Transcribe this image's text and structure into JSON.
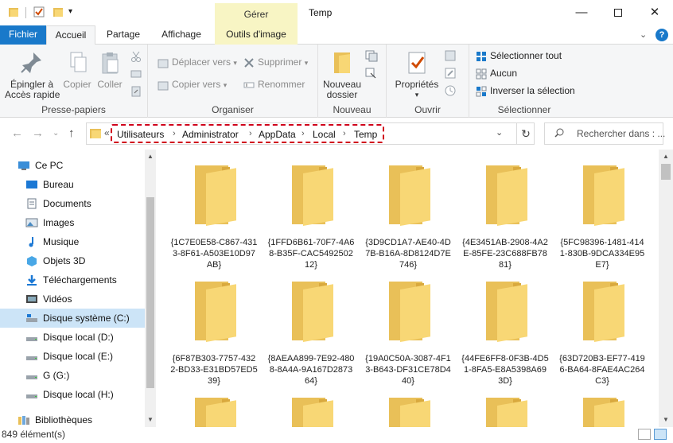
{
  "window": {
    "title": "Temp",
    "context_tab_header": "Gérer",
    "minimize": "—",
    "close": "✕"
  },
  "ribbon_tabs": [
    "Fichier",
    "Accueil",
    "Partage",
    "Affichage",
    "Outils d'image"
  ],
  "help": "?",
  "ribbon": {
    "presse_papiers": {
      "label": "Presse-papiers",
      "pin": "Épingler à\nAccès rapide",
      "copy": "Copier",
      "paste": "Coller"
    },
    "organiser": {
      "label": "Organiser",
      "move_to": "Déplacer vers",
      "copy_to": "Copier vers",
      "delete": "Supprimer",
      "rename": "Renommer"
    },
    "nouveau": {
      "label": "Nouveau",
      "new_folder": "Nouveau\ndossier"
    },
    "ouvrir": {
      "label": "Ouvrir",
      "properties": "Propriétés"
    },
    "selectionner": {
      "label": "Sélectionner",
      "select_all": "Sélectionner tout",
      "select_none": "Aucun",
      "invert": "Inverser la sélection"
    }
  },
  "address": {
    "prefix": "«",
    "crumbs": [
      "Utilisateurs",
      "Administrator",
      "AppData",
      "Local",
      "Temp"
    ],
    "separator": "›"
  },
  "search": {
    "placeholder": "Rechercher dans : ..."
  },
  "sidebar": [
    {
      "label": "Ce PC",
      "icon": "pc-icon",
      "indent": 0
    },
    {
      "label": "Bureau",
      "icon": "desktop-icon",
      "indent": 1
    },
    {
      "label": "Documents",
      "icon": "documents-icon",
      "indent": 1
    },
    {
      "label": "Images",
      "icon": "images-icon",
      "indent": 1
    },
    {
      "label": "Musique",
      "icon": "music-icon",
      "indent": 1
    },
    {
      "label": "Objets 3D",
      "icon": "objects3d-icon",
      "indent": 1
    },
    {
      "label": "Téléchargements",
      "icon": "downloads-icon",
      "indent": 1
    },
    {
      "label": "Vidéos",
      "icon": "videos-icon",
      "indent": 1
    },
    {
      "label": "Disque système (C:)",
      "icon": "system-drive-icon",
      "indent": 1,
      "selected": true
    },
    {
      "label": "Disque local (D:)",
      "icon": "drive-icon",
      "indent": 1
    },
    {
      "label": "Disque local (E:)",
      "icon": "drive-icon",
      "indent": 1
    },
    {
      "label": "G (G:)",
      "icon": "drive-icon",
      "indent": 1
    },
    {
      "label": "Disque local (H:)",
      "icon": "drive-icon",
      "indent": 1
    },
    {
      "label": "Bibliothèques",
      "icon": "libraries-icon",
      "indent": 0
    }
  ],
  "folders": [
    "{1C7E0E58-C867-4313-8F61-A503E10D97AB}",
    "{1FFD6B61-70F7-4A68-B35F-CAC549250212}",
    "{3D9CD1A7-AE40-4D7B-B16A-8D8124D7E746}",
    "{4E3451AB-2908-4A2E-85FE-23C688FB7881}",
    "{5FC98396-1481-4141-830B-9DCA334E95E7}",
    "{6F87B303-7757-4322-BD33-E31BD57ED539}",
    "{8AEAA899-7E92-4808-8A4A-9A167D287364}",
    "{19A0C50A-3087-4F13-B643-DF31CE78D440}",
    "{44FE6FF8-0F3B-4D51-8FA5-E8A5398A693D}",
    "{63D720B3-EF77-4196-BA64-8FAE4AC264C3}",
    "",
    "",
    "",
    "",
    ""
  ],
  "status": {
    "count": "849 élément(s)"
  },
  "colors": {
    "accent": "#1979ca",
    "context_tab": "#f8f5c4",
    "selection": "#cce4f7",
    "highlight_border": "#d0021b",
    "folder_front": "#f8d775",
    "folder_back": "#e9c058"
  }
}
